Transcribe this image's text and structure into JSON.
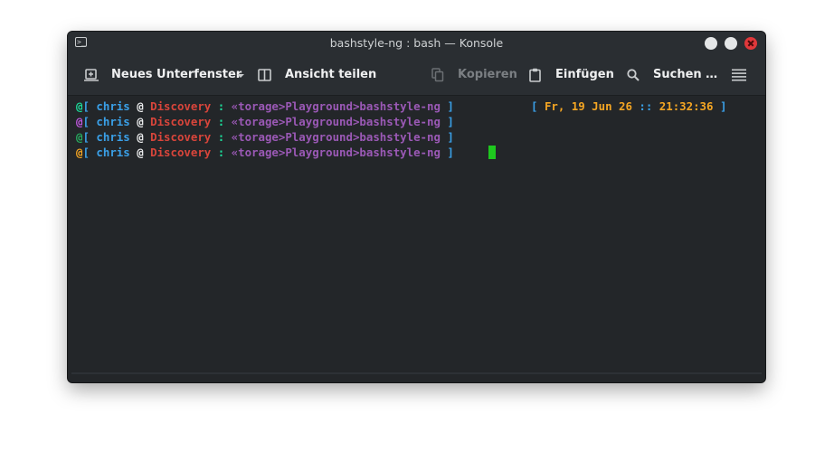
{
  "window": {
    "title": "bashstyle-ng : bash — Konsole"
  },
  "toolbar": {
    "new_tab": "Neues Unterfenster",
    "split_view": "Ansicht teilen",
    "copy": "Kopieren",
    "paste": "Einfügen",
    "find": "Suchen …"
  },
  "terminal": {
    "prompt_lines": [
      {
        "at": "@",
        "open": "[",
        "user": "chris",
        "sep": "@",
        "host": "Discovery",
        "colon": ":",
        "path": "«torage>Playground>bashstyle-ng",
        "close": "]"
      },
      {
        "at": "@",
        "open": "[",
        "user": "chris",
        "sep": "@",
        "host": "Discovery",
        "colon": ":",
        "path": "«torage>Playground>bashstyle-ng",
        "close": "]"
      },
      {
        "at": "@",
        "open": "[",
        "user": "chris",
        "sep": "@",
        "host": "Discovery",
        "colon": ":",
        "path": "«torage>Playground>bashstyle-ng",
        "close": "]"
      },
      {
        "at": "@",
        "open": "[",
        "user": "chris",
        "sep": "@",
        "host": "Discovery",
        "colon": ":",
        "path": "«torage>Playground>bashstyle-ng",
        "close": "]"
      }
    ],
    "clock": {
      "open": "[",
      "date": "Fr, 19 Jun 26",
      "sep": "::",
      "time": "21:32:36",
      "close": "]"
    }
  },
  "colors": {
    "background": "#232629",
    "user": "#3aa0e8",
    "host": "#d8453b",
    "colon": "#1cdc9a",
    "path": "#9b59b6",
    "cursor": "#1ec81e"
  }
}
